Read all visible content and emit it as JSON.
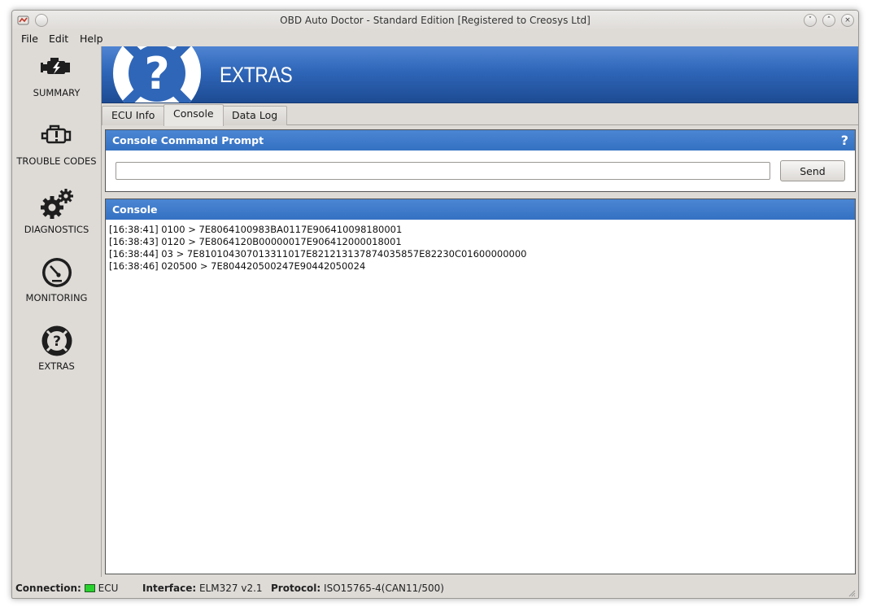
{
  "window": {
    "title": "OBD Auto Doctor - Standard Edition [Registered to Creosys Ltd]",
    "minimize_glyph": "˅",
    "maximize_glyph": "˄",
    "close_glyph": "×"
  },
  "menu": {
    "file": "File",
    "edit": "Edit",
    "help": "Help"
  },
  "sidebar": {
    "items": [
      {
        "label": "SUMMARY",
        "icon": "engine-bolt-icon"
      },
      {
        "label": "TROUBLE CODES",
        "icon": "engine-warning-icon"
      },
      {
        "label": "DIAGNOSTICS",
        "icon": "gears-icon"
      },
      {
        "label": "MONITORING",
        "icon": "gauge-icon"
      },
      {
        "label": "EXTRAS",
        "icon": "question-lifebuoy-icon"
      }
    ]
  },
  "banner": {
    "title": "EXTRAS",
    "icon": "question-lifebuoy-icon"
  },
  "tabs": [
    {
      "label": "ECU Info",
      "active": false
    },
    {
      "label": "Console",
      "active": true
    },
    {
      "label": "Data Log",
      "active": false
    }
  ],
  "command_prompt": {
    "title": "Console Command Prompt",
    "help_glyph": "?",
    "input_value": "",
    "send_label": "Send"
  },
  "console": {
    "title": "Console",
    "lines": [
      "[16:38:41] 0100 > 7E8064100983BA0117E906410098180001",
      "[16:38:43] 0120 > 7E8064120B00000017E906412000018001",
      "[16:38:44] 03 > 7E810104307013311017E821213137874035857E82230C01600000000",
      "[16:38:46] 020500 > 7E804420500247E90442050024"
    ]
  },
  "status": {
    "connection_label": "Connection:",
    "connection_value": "ECU",
    "connection_color": "#29d12e",
    "interface_label": "Interface:",
    "interface_value": "ELM327 v2.1",
    "protocol_label": "Protocol:",
    "protocol_value": "ISO15765-4(CAN11/500)"
  },
  "colors": {
    "accent": "#3571c2",
    "banner_dark": "#1d4b93",
    "window_bg": "#dedbd7"
  }
}
